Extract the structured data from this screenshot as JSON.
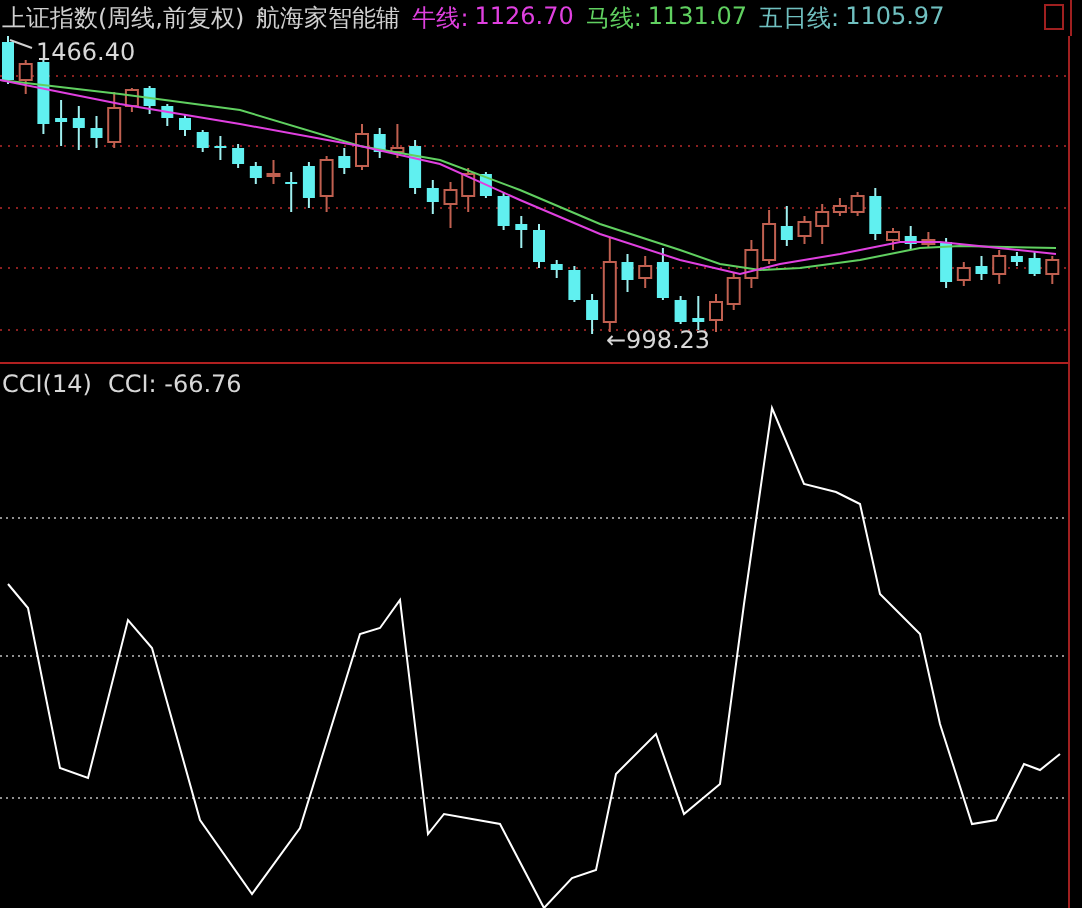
{
  "header": {
    "title": "上证指数(周线,前复权)",
    "indicator_name": "航海家智能辅",
    "legend": [
      {
        "label": "牛线:",
        "value": "1126.70",
        "color": "#e040e0"
      },
      {
        "label": "马线:",
        "value": "1131.07",
        "color": "#60d060"
      },
      {
        "label": "五日线:",
        "value": "1105.97",
        "color": "#70c0c0"
      }
    ]
  },
  "price_chart": {
    "high_label": "1466.40",
    "low_label": "←998.23"
  },
  "cci_panel": {
    "title": "CCI(14)",
    "reading_label": "CCI:",
    "reading": "-66.76"
  }
}
